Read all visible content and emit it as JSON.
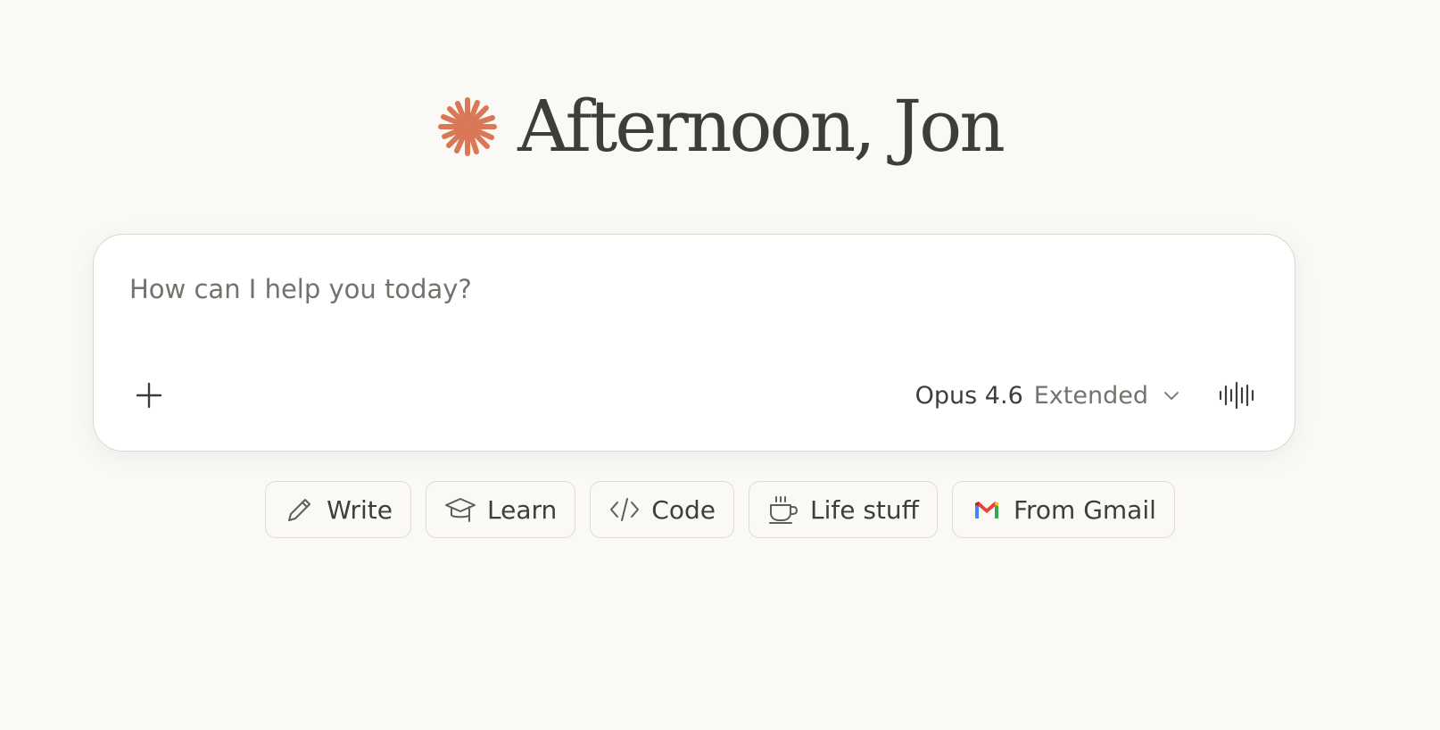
{
  "greeting": {
    "title": "Afternoon, Jon",
    "icon": "claude-spark-icon",
    "icon_color": "#d97757"
  },
  "composer": {
    "placeholder": "How can I help you today?",
    "value": "",
    "add_icon": "plus-icon",
    "model_name": "Opus 4.6",
    "model_mode": "Extended",
    "dropdown_icon": "chevron-down-icon",
    "voice_icon": "voice-waveform-icon"
  },
  "chips": [
    {
      "label": "Write",
      "icon": "pencil-icon"
    },
    {
      "label": "Learn",
      "icon": "graduation-cap-icon"
    },
    {
      "label": "Code",
      "icon": "code-icon"
    },
    {
      "label": "Life stuff",
      "icon": "coffee-cup-icon"
    },
    {
      "label": "From Gmail",
      "icon": "gmail-icon"
    }
  ],
  "colors": {
    "background": "#faf9f5",
    "accent": "#d97757",
    "text": "#3d3d3a",
    "muted_text": "#73726c"
  }
}
